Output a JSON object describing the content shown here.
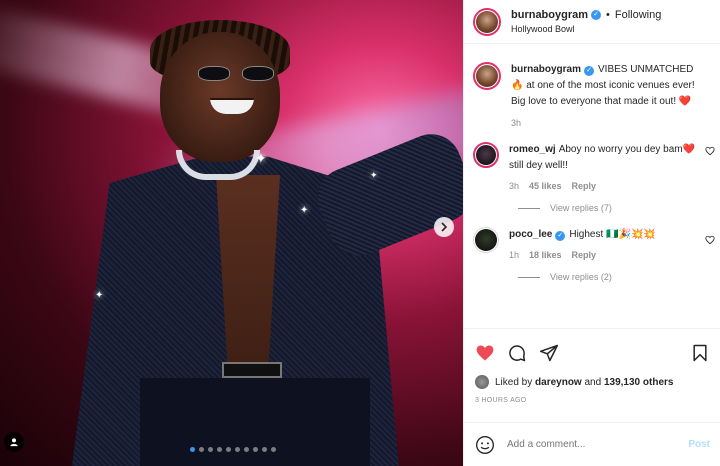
{
  "post": {
    "username": "burnaboygram",
    "follow_state": "Following",
    "location": "Hollywood Bowl",
    "caption_user": "burnaboygram",
    "caption": "VIBES UNMATCHED 🔥 at one of the most iconic venues ever! Big love to everyone that made it out! ❤️",
    "caption_time": "3h"
  },
  "comments": [
    {
      "user": "romeo_wj",
      "text": "Aboy no worry you dey bam❤️ still dey well!!",
      "time": "3h",
      "likes": "45 likes",
      "reply_label": "Reply",
      "view_replies": "View replies (7)"
    },
    {
      "user": "poco_lee",
      "text": "Highest 🇳🇬🎉💥💥",
      "time": "1h",
      "likes": "18 likes",
      "reply_label": "Reply",
      "view_replies": "View replies (2)"
    }
  ],
  "engagement": {
    "liked_by_prefix": "Liked by",
    "liked_by_user": "dareynow",
    "and": "and",
    "others": "139,130 others",
    "timestamp": "3 HOURS AGO"
  },
  "composer": {
    "placeholder": "Add a comment...",
    "post_label": "Post"
  },
  "carousel": {
    "slide_count": 10,
    "active_index": 0
  },
  "colors": {
    "verified": "#3897f0",
    "like_red": "#ed4956",
    "post_disabled": "#b2dffc",
    "muted": "#8e8e8e"
  }
}
